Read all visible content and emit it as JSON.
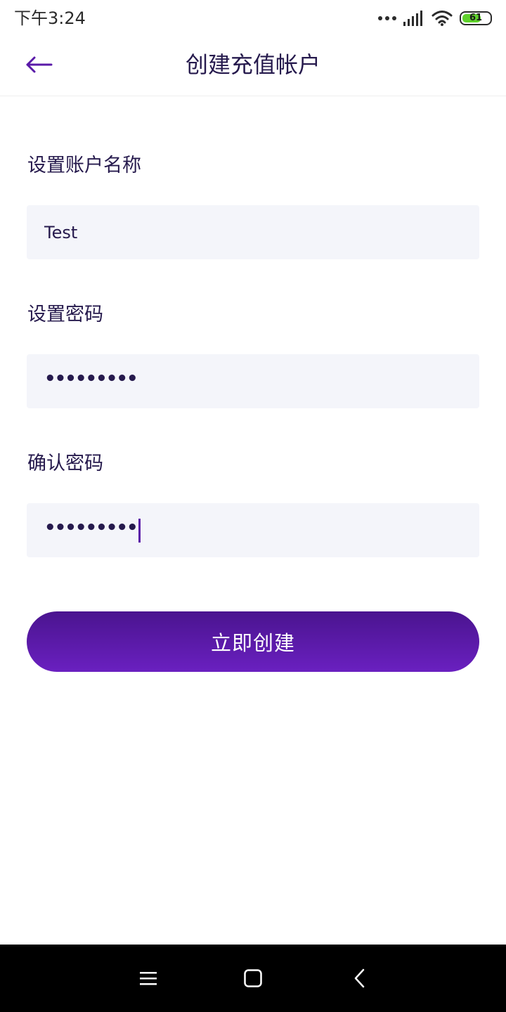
{
  "status_bar": {
    "time": "下午3:24",
    "battery_level": "61"
  },
  "header": {
    "title": "创建充值帐户"
  },
  "form": {
    "account_name": {
      "label": "设置账户名称",
      "value": "Test"
    },
    "password": {
      "label": "设置密码",
      "value": "•••••••••"
    },
    "confirm_password": {
      "label": "确认密码",
      "value": "•••••••••"
    }
  },
  "submit_button": {
    "label": "立即创建"
  },
  "colors": {
    "accent": "#5a1aa8",
    "title_text": "#261a4d",
    "field_background": "#f4f5fa",
    "button_gradient_top": "#4a148f",
    "button_gradient_bottom": "#6a20c0",
    "battery_green": "#5fd12b"
  },
  "icons": {
    "back": "arrow-left-icon",
    "nav_menu": "menu-icon",
    "nav_home": "home-square-icon",
    "nav_back": "chevron-left-icon"
  }
}
